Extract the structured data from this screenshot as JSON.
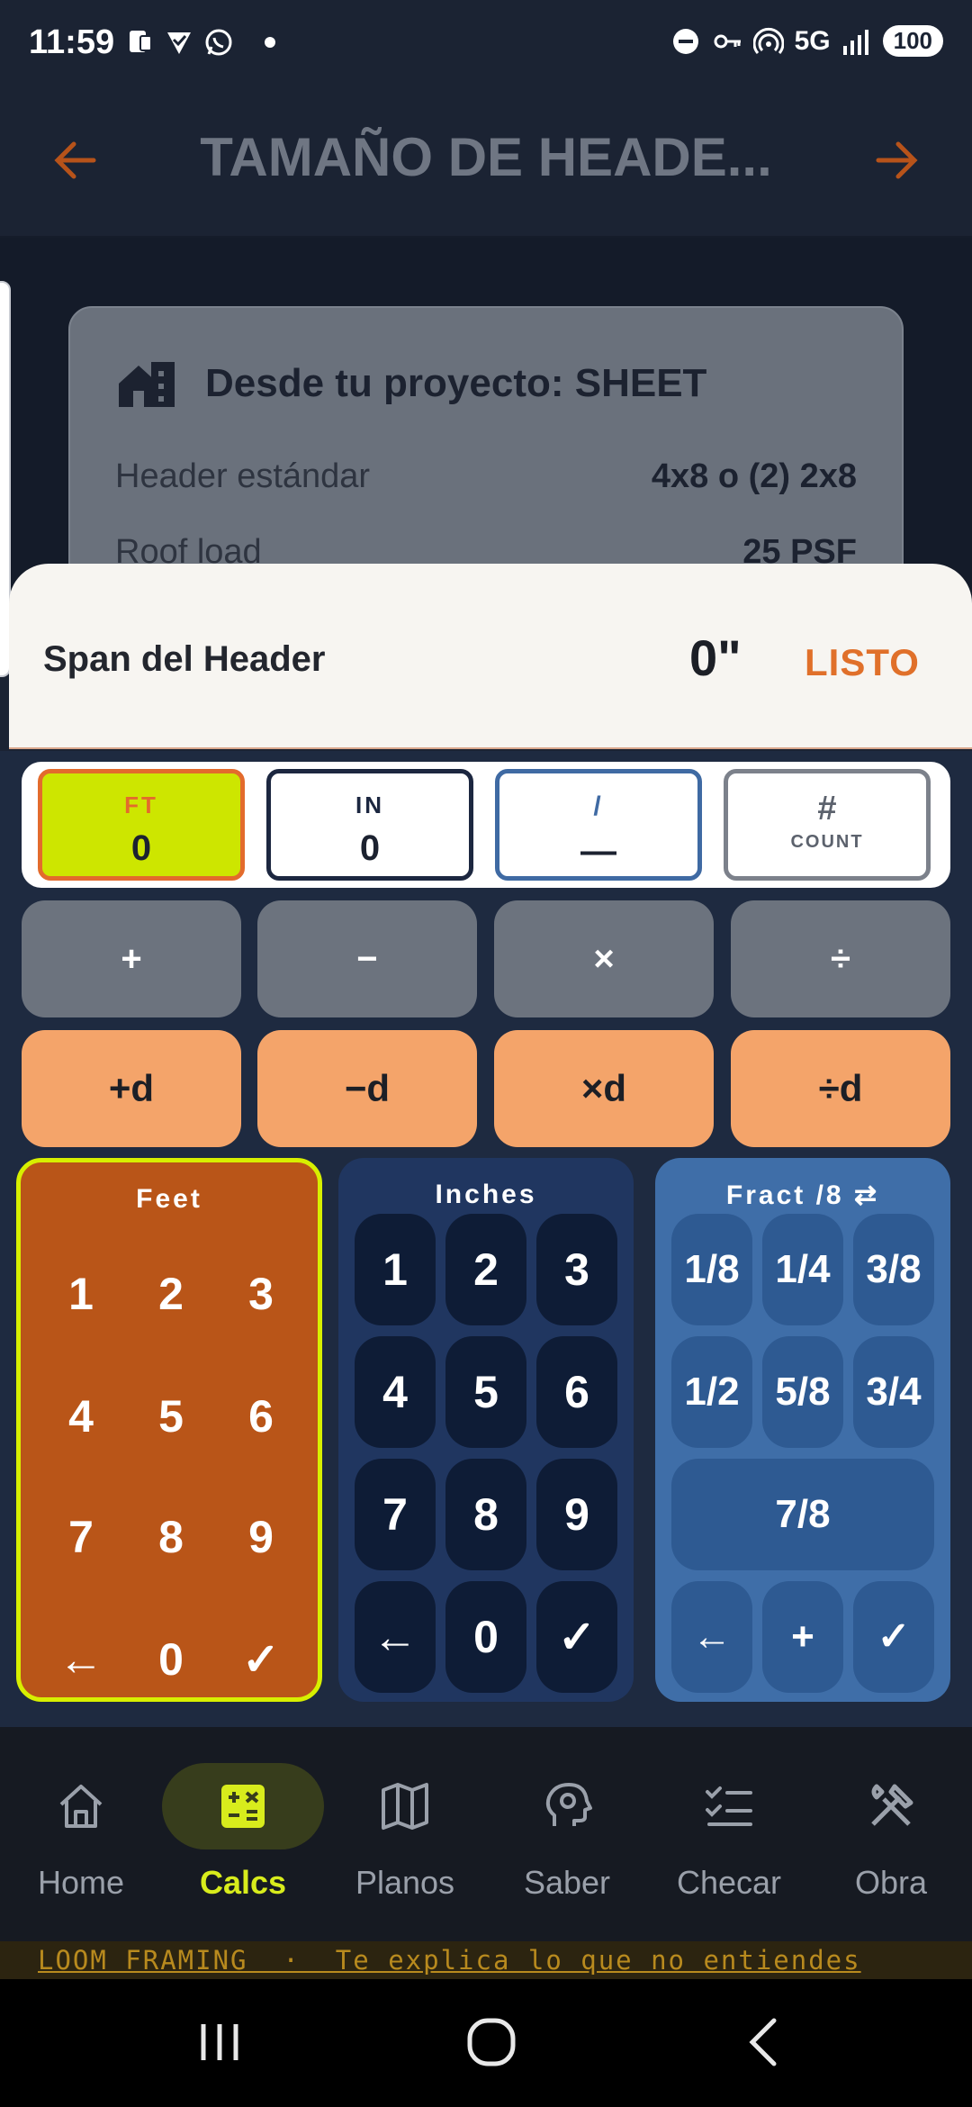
{
  "status_bar": {
    "time": "11:59",
    "network": "5G",
    "battery": "100",
    "icons": [
      "notification-icon",
      "vpn-check-icon",
      "whatsapp-icon",
      "dot-icon",
      "dnd-icon",
      "key-icon",
      "hotspot-icon",
      "signal-icon"
    ]
  },
  "header": {
    "title": "TAMAÑO DE HEADE...",
    "back_icon": "arrow-left-icon",
    "forward_icon": "arrow-right-icon",
    "accent": "#b7531a"
  },
  "project_card": {
    "title": "Desde tu proyecto: SHEET",
    "rows": [
      {
        "label": "Header estándar",
        "value": "4x8 o (2) 2x8"
      },
      {
        "label": "Roof load",
        "value": "25 PSF"
      }
    ]
  },
  "input_sheet": {
    "label": "Span del Header",
    "value": "0\"",
    "done_label": "LISTO"
  },
  "calculator": {
    "modes": [
      {
        "label": "FT",
        "value": "0",
        "active": true
      },
      {
        "label": "IN",
        "value": "0"
      },
      {
        "label": "/",
        "value": "—"
      },
      {
        "symbol": "#",
        "label": "COUNT"
      }
    ],
    "operators": [
      "+",
      "−",
      "×",
      "÷"
    ],
    "dimension_operators": [
      "+d",
      "−d",
      "×d",
      "÷d"
    ],
    "feet_pad": {
      "title": "Feet",
      "keys": [
        "1",
        "2",
        "3",
        "4",
        "5",
        "6",
        "7",
        "8",
        "9",
        "←",
        "0",
        "✓"
      ]
    },
    "inches_pad": {
      "title": "Inches",
      "keys": [
        "1",
        "2",
        "3",
        "4",
        "5",
        "6",
        "7",
        "8",
        "9",
        "←",
        "0",
        "✓"
      ]
    },
    "fraction_pad": {
      "title": "Fract /8 ⇄",
      "keys": [
        "1/8",
        "1/4",
        "3/8",
        "1/2",
        "5/8",
        "3/4",
        "7/8",
        "←",
        "+",
        "✓"
      ]
    },
    "colors": {
      "feet": "#b95518",
      "feet_border": "#d7ef00",
      "inches": "#203660",
      "fraction": "#3f6ea8",
      "dim_ops": "#f4a46a"
    }
  },
  "bottom_nav": {
    "items": [
      {
        "label": "Home",
        "icon": "home-icon"
      },
      {
        "label": "Calcs",
        "icon": "calculator-icon",
        "active": true
      },
      {
        "label": "Planos",
        "icon": "map-icon"
      },
      {
        "label": "Saber",
        "icon": "brain-icon"
      },
      {
        "label": "Checar",
        "icon": "checklist-icon"
      },
      {
        "label": "Obra",
        "icon": "tools-icon"
      }
    ]
  },
  "marquee": {
    "text": "LOOM FRAMING  ·  Te explica lo que no entiendes"
  },
  "system_nav": {
    "icons": [
      "recents-icon",
      "home-circle-icon",
      "back-chevron-icon"
    ]
  }
}
